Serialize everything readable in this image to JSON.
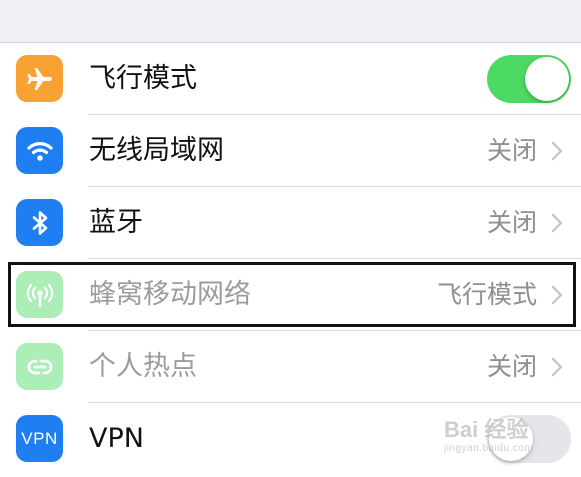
{
  "settings": {
    "items": [
      {
        "label": "飞行模式",
        "value": "",
        "control": "toggle",
        "toggle_on": true,
        "enabled": true,
        "icon": "airplane-icon",
        "icon_color": "#f7a233"
      },
      {
        "label": "无线局域网",
        "value": "关闭",
        "control": "chevron",
        "enabled": true,
        "icon": "wifi-icon",
        "icon_color": "#1e7ef2"
      },
      {
        "label": "蓝牙",
        "value": "关闭",
        "control": "chevron",
        "enabled": true,
        "icon": "bluetooth-icon",
        "icon_color": "#1e7ef2"
      },
      {
        "label": "蜂窝移动网络",
        "value": "飞行模式",
        "control": "chevron",
        "enabled": false,
        "icon": "cellular-icon",
        "icon_color": "#4cd964"
      },
      {
        "label": "个人热点",
        "value": "关闭",
        "control": "chevron",
        "enabled": false,
        "icon": "hotspot-icon",
        "icon_color": "#4cd964"
      },
      {
        "label": "VPN",
        "value": "",
        "control": "toggle",
        "toggle_on": false,
        "enabled": true,
        "icon": "vpn-icon",
        "icon_color": "#1e7ef2",
        "icon_text": "VPN"
      }
    ]
  },
  "colors": {
    "toggle_on": "#4cd964",
    "secondary_text": "#8e8e93",
    "background": "#efeff4"
  },
  "watermark": {
    "main": "Bai 经验",
    "sub": "jingyan.baidu.com"
  }
}
